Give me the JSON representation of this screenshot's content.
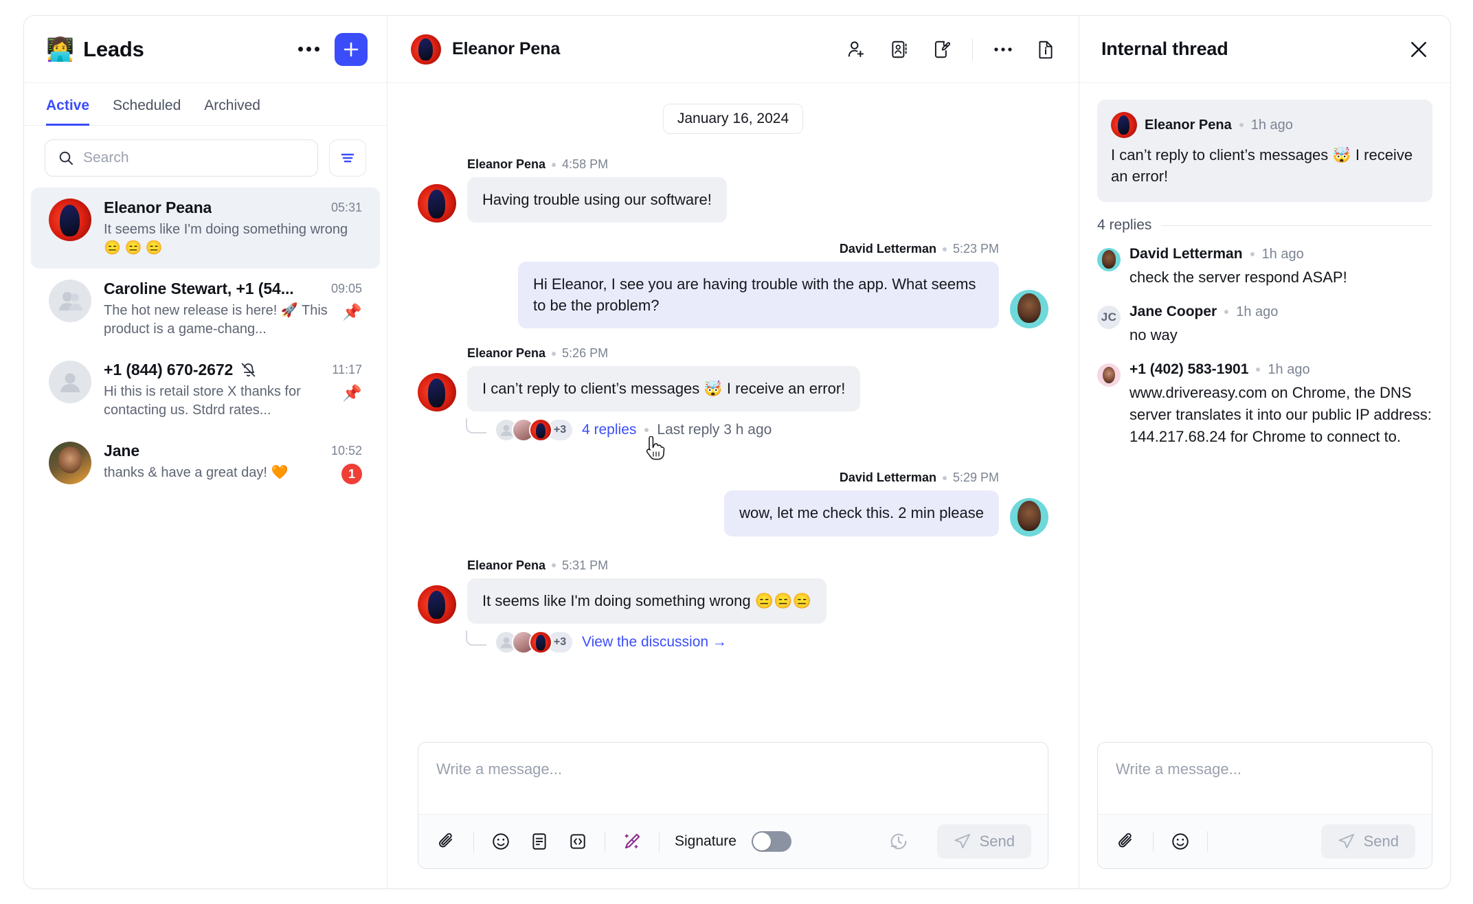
{
  "sidebar": {
    "emoji": "👩‍💻",
    "title": "Leads",
    "more_label": "more-options",
    "add_label": "+",
    "tabs": [
      {
        "label": "Active",
        "active": true
      },
      {
        "label": "Scheduled",
        "active": false
      },
      {
        "label": "Archived",
        "active": false
      }
    ],
    "search": {
      "placeholder": "Search",
      "value": ""
    },
    "filter_label": "filter",
    "conversations": [
      {
        "name": "Eleanor Peana",
        "time": "05:31",
        "preview": "It seems like I'm doing something wrong 😑 😑 😑",
        "selected": true,
        "muted": false,
        "pinned": false,
        "badge": ""
      },
      {
        "name": "Caroline Stewart, +1 (54...",
        "time": "09:05",
        "preview": "The hot new release is here! 🚀 This product is a game-chang...",
        "selected": false,
        "muted": false,
        "pinned": true,
        "badge": ""
      },
      {
        "name": "+1 (844) 670-2672",
        "time": "11:17",
        "preview": "Hi this is retail store X thanks for contacting us. Stdrd rates...",
        "selected": false,
        "muted": true,
        "pinned": true,
        "badge": ""
      },
      {
        "name": "Jane",
        "time": "10:52",
        "preview": "thanks & have a great day! 🧡",
        "selected": false,
        "muted": false,
        "pinned": false,
        "badge": "1"
      }
    ]
  },
  "chat": {
    "header": {
      "name": "Eleanor Pena",
      "icons": [
        "add-contact-icon",
        "contact-card-icon",
        "edit-note-icon",
        "more-options-icon",
        "info-document-icon"
      ]
    },
    "date_chip": "January 16, 2024",
    "messages": [
      {
        "author": "Eleanor Pena",
        "time": "4:58 PM",
        "text": "Having trouble using our software!",
        "direction": "inbound",
        "avatar": "eleanor"
      },
      {
        "author": "David Letterman",
        "time": "5:23 PM",
        "text": "Hi Eleanor, I see you are having trouble with the app. What seems to be the problem?",
        "direction": "outbound",
        "avatar": "david"
      },
      {
        "author": "Eleanor Pena",
        "time": "5:26 PM",
        "text": "I can’t reply to client’s messages 🤯 I receive an error!",
        "direction": "inbound",
        "avatar": "eleanor",
        "thread": {
          "overflow": "+3",
          "link": "4 replies",
          "meta": "Last reply 3 h ago"
        }
      },
      {
        "author": "David Letterman",
        "time": "5:29 PM",
        "text": "wow, let me check this. 2 min please",
        "direction": "outbound",
        "avatar": "david"
      },
      {
        "author": "Eleanor Pena",
        "time": "5:31 PM",
        "text": "It seems like I'm doing something wrong 😑😑😑",
        "direction": "inbound",
        "avatar": "eleanor",
        "thread": {
          "overflow": "+3",
          "link": "View the discussion →",
          "meta": ""
        }
      }
    ],
    "composer": {
      "placeholder": "Write a message...",
      "value": "",
      "signature_label": "Signature",
      "signature_on": false,
      "send_label": "Send",
      "icons": [
        "attachment-icon",
        "emoji-icon",
        "template-icon",
        "code-snippet-icon",
        "ai-magic-icon",
        "schedule-icon",
        "send-icon"
      ]
    }
  },
  "thread_panel": {
    "title": "Internal thread",
    "close_label": "close",
    "root": {
      "author": "Eleanor Pena",
      "time": "1h ago",
      "text": "I can’t reply to client’s messages 🤯 I receive an error!"
    },
    "replies_count": "4 replies",
    "replies": [
      {
        "author": "David Letterman",
        "time": "1h ago",
        "text": "check the server respond ASAP!",
        "avatar": "david"
      },
      {
        "author": "Jane Cooper",
        "time": "1h ago",
        "text": "no way",
        "avatar": "initials",
        "initials": "JC"
      },
      {
        "author": "+1 (402) 583-1901",
        "time": "1h ago",
        "text": "www.drivereasy.com on Chrome, the DNS server translates it into our public IP address: 144.217.68.24 for Chrome to connect to.",
        "avatar": "pink"
      }
    ],
    "composer": {
      "placeholder": "Write a message...",
      "value": "",
      "send_label": "Send",
      "icons": [
        "attachment-icon",
        "emoji-icon",
        "send-icon"
      ]
    }
  },
  "colors": {
    "accent": "#3b4dfa",
    "badge": "#ef3e36",
    "inbound_bubble": "#eef0f4",
    "outbound_bubble": "#e9ebfb",
    "ai_icon": "#8b2e8f"
  }
}
